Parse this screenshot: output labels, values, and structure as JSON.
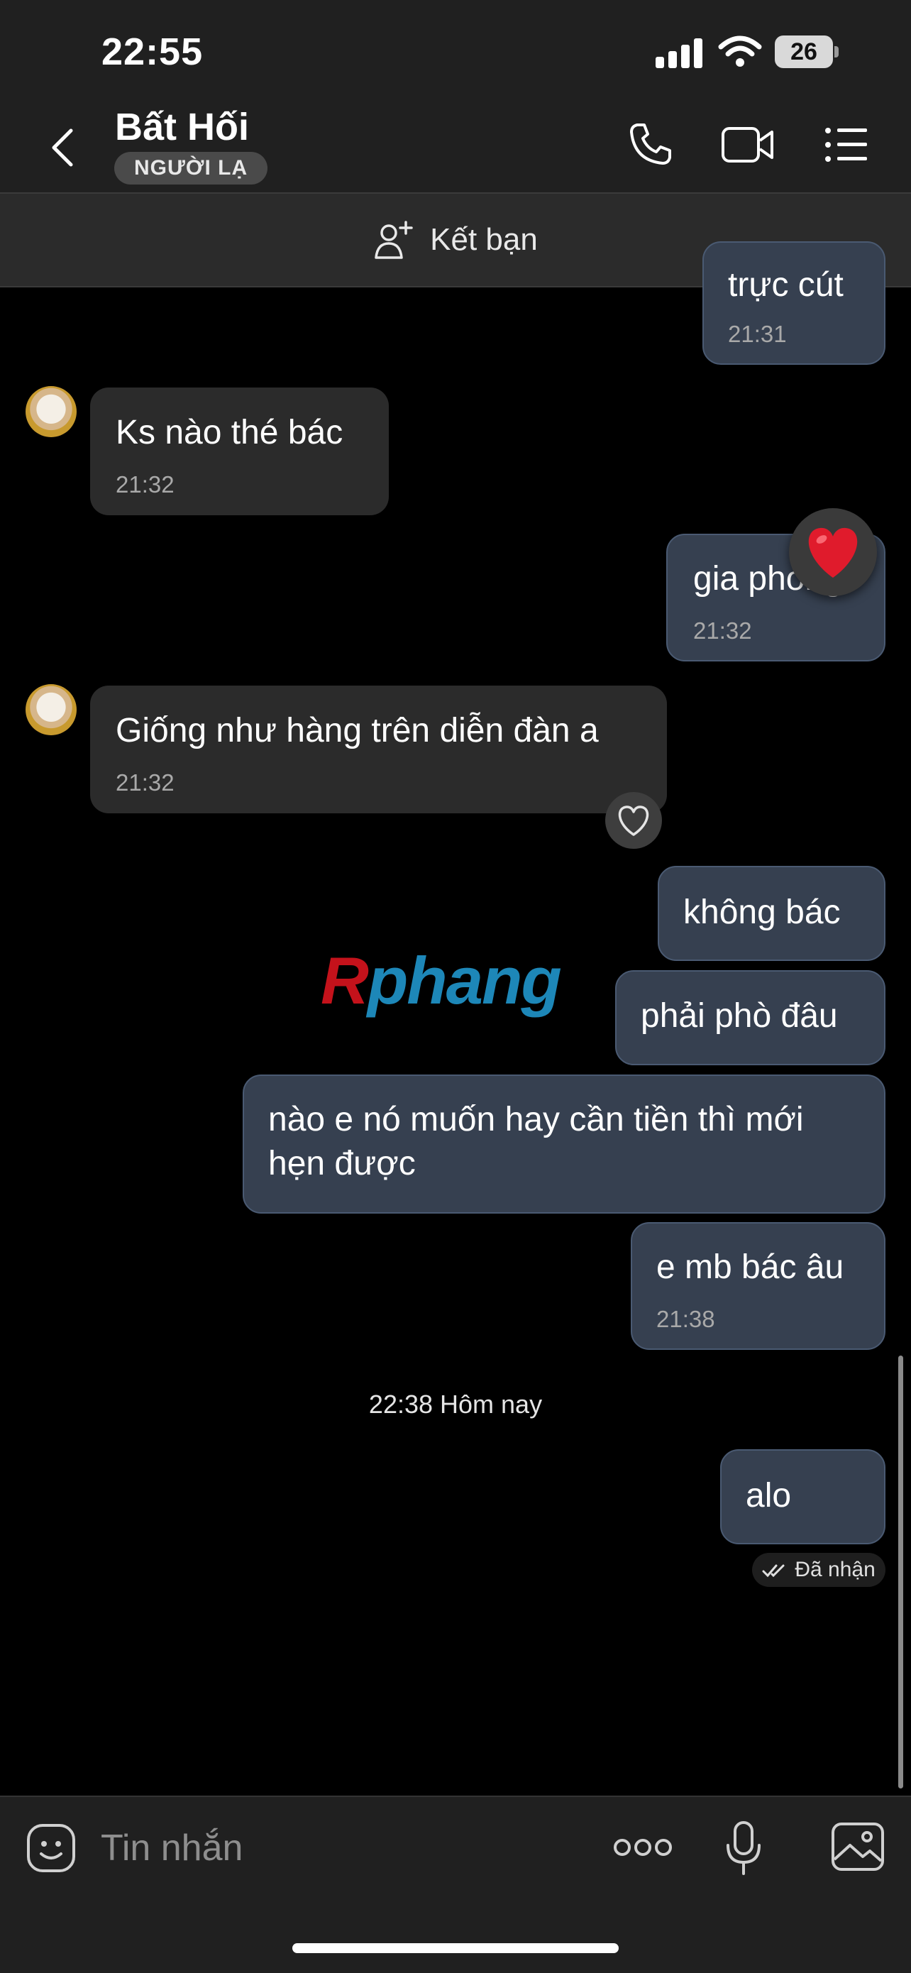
{
  "status": {
    "time": "22:55",
    "battery": "26"
  },
  "header": {
    "name": "Bất Hối",
    "badge": "NGƯỜI LẠ"
  },
  "add_friend": {
    "label": "Kết bạn"
  },
  "messages": [
    {
      "side": "out",
      "text": "trực cút",
      "time": "21:31"
    },
    {
      "side": "in",
      "text": "Ks nào thé bác",
      "time": "21:32"
    },
    {
      "side": "out",
      "text": "gia phong",
      "time": "21:32",
      "reaction": "heart"
    },
    {
      "side": "in",
      "text": "Giống như hàng trên diễn đàn a",
      "time": "21:32"
    },
    {
      "side": "out",
      "text": "không bác"
    },
    {
      "side": "out",
      "text": "phải phò đâu"
    },
    {
      "side": "out",
      "text_line1": "nào e nó muốn hay cần tiền thì mới",
      "text_line2": "hẹn được"
    },
    {
      "side": "out",
      "text": "e mb bác âu",
      "time": "21:38"
    },
    {
      "side": "out",
      "text": "alo"
    }
  ],
  "date_separator": "22:38 Hôm nay",
  "receipt": "Đã nhận",
  "watermark": {
    "first": "R",
    "rest": "phang"
  },
  "composer": {
    "placeholder": "Tin nhắn"
  },
  "colors": {
    "incoming": "#2b2b2b",
    "outgoing": "#364050",
    "background": "#000000"
  }
}
